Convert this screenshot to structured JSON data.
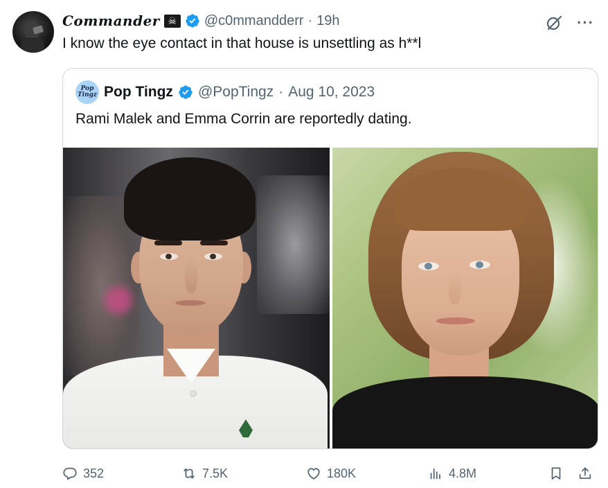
{
  "tweet": {
    "display_name": "Commander",
    "flag_icon": "skull-crossbones-flag",
    "handle": "@c0mmandderr",
    "separator": "·",
    "time": "19h",
    "text": "I know the eye contact in that house is unsettling as h**l"
  },
  "quote": {
    "avatar_text": "Pop Tingz",
    "display_name": "Pop Tingz",
    "handle": "@PopTingz",
    "separator": "·",
    "date": "Aug 10, 2023",
    "text": "Rami Malek and Emma Corrin are reportedly dating."
  },
  "actions": {
    "replies": "352",
    "reposts": "7.5K",
    "likes": "180K",
    "views": "4.8M"
  },
  "colors": {
    "text": "#0f1419",
    "muted": "#536471",
    "verified": "#1d9bf0",
    "border": "#cfd9de"
  },
  "icons": [
    "grok-icon",
    "more-icon",
    "verified-icon",
    "reply-icon",
    "repost-icon",
    "like-icon",
    "views-icon",
    "bookmark-icon",
    "share-icon"
  ]
}
